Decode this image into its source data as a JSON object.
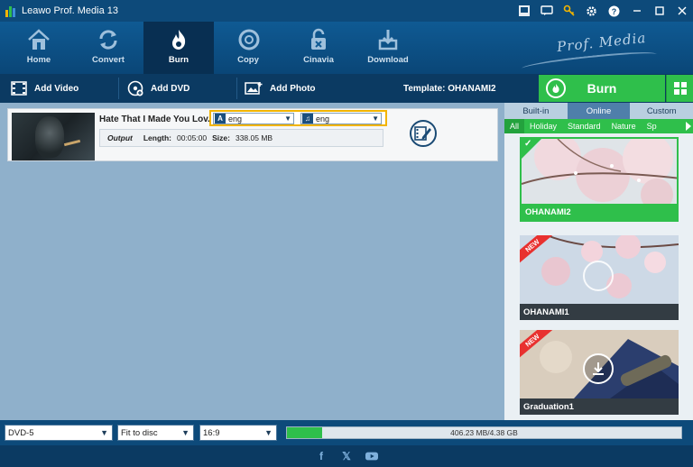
{
  "window": {
    "title": "Leawo Prof. Media 13"
  },
  "nav": {
    "items": [
      {
        "label": "Home",
        "icon": "home-icon"
      },
      {
        "label": "Convert",
        "icon": "convert-icon"
      },
      {
        "label": "Burn",
        "icon": "burn-icon",
        "active": true
      },
      {
        "label": "Copy",
        "icon": "copy-icon"
      },
      {
        "label": "Cinavia",
        "icon": "cinavia-icon"
      },
      {
        "label": "Download",
        "icon": "download-icon"
      }
    ],
    "brand": "Prof. Media"
  },
  "toolbar": {
    "add_video": "Add Video",
    "add_dvd": "Add DVD",
    "add_photo": "Add Photo",
    "template": "Template: OHANAMI2",
    "burn": "Burn"
  },
  "video": {
    "title": "Hate That I Made You Lov...",
    "subtitle": "eng",
    "audio": "eng",
    "output_label": "Output",
    "length_label": "Length:",
    "length": "00:05:00",
    "size_label": "Size:",
    "size": "338.05 MB"
  },
  "templates": {
    "tabs": [
      "Built-in",
      "Online",
      "Custom"
    ],
    "active_tab": "Online",
    "categories": [
      "All",
      "Holiday",
      "Standard",
      "Nature",
      "Sp"
    ],
    "new_badge": "NEW",
    "items": [
      {
        "name": "OHANAMI2",
        "selected": true
      },
      {
        "name": "OHANAMI1",
        "is_new": true
      },
      {
        "name": "Graduation1",
        "is_new": true
      }
    ]
  },
  "bottom": {
    "disc_type": "DVD-5",
    "fit": "Fit to disc",
    "aspect": "16:9",
    "capacity_text": "406.23 MB/4.38 GB",
    "capacity_fraction": 0.09
  },
  "colors": {
    "accent_green": "#2fbf4b",
    "title_blue": "#0d4a7a",
    "work_area": "#8fb0cb",
    "highlight": "#f2b400"
  }
}
